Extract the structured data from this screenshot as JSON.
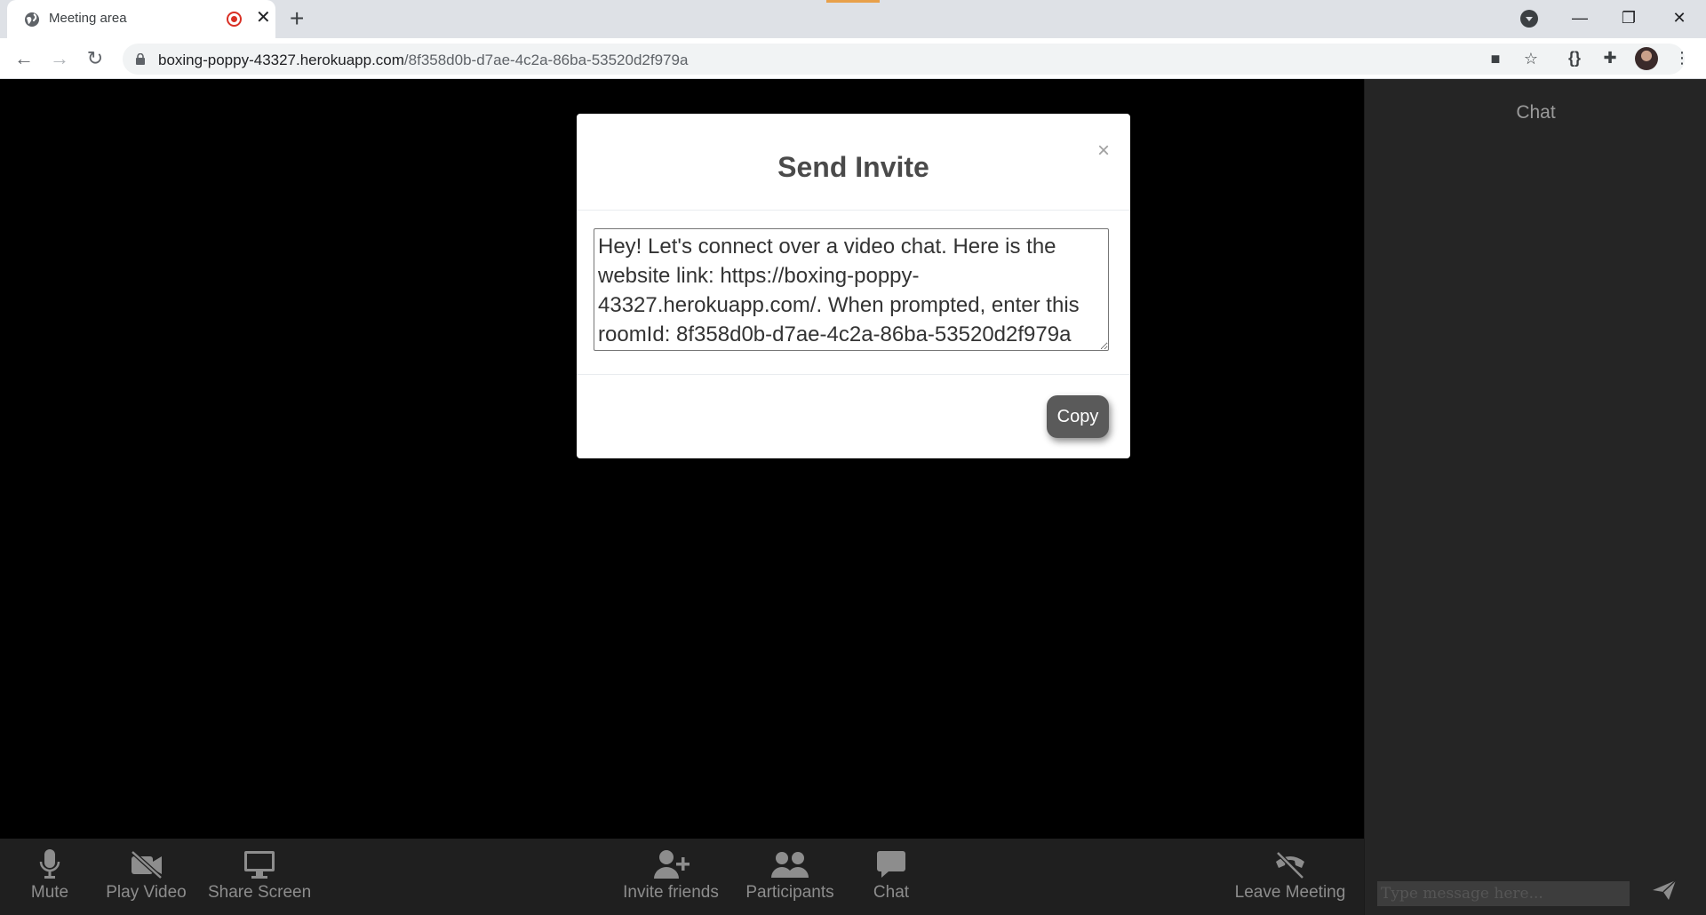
{
  "browser": {
    "tab_title": "Meeting area",
    "url_host": "boxing-poppy-43327.herokuapp.com",
    "url_path": "/8f358d0b-d7ae-4c2a-86ba-53520d2f979a",
    "close_glyph": "✕",
    "new_tab_glyph": "+",
    "back_glyph": "←",
    "forward_glyph": "→",
    "reload_glyph": "↻",
    "minimize_glyph": "—",
    "restore_glyph": "❐",
    "window_close_glyph": "✕",
    "camera_glyph": "■",
    "star_glyph": "☆",
    "json_glyph": "{}",
    "extensions_glyph": "✚",
    "menu_glyph": "⋮"
  },
  "modal": {
    "title": "Send Invite",
    "close_glyph": "×",
    "invite_message": "Hey! Let's connect over a video chat. Here is the website link: https://boxing-poppy-43327.herokuapp.com/. When prompted, enter this roomId: 8f358d0b-d7ae-4c2a-86ba-53520d2f979a",
    "copy_label": "Copy"
  },
  "controls": {
    "mute": "Mute",
    "play_video": "Play Video",
    "share_screen": "Share Screen",
    "invite_friends": "Invite friends",
    "participants": "Participants",
    "chat": "Chat",
    "leave_meeting": "Leave Meeting"
  },
  "chat": {
    "title": "Chat",
    "placeholder": "Type message here..."
  },
  "colors": {
    "stage": "#000000",
    "control_bar": "#1f1f1f",
    "chat_panel": "#252525",
    "control_icon": "#8d8d8d",
    "copy_button": "#5a5a5a"
  }
}
